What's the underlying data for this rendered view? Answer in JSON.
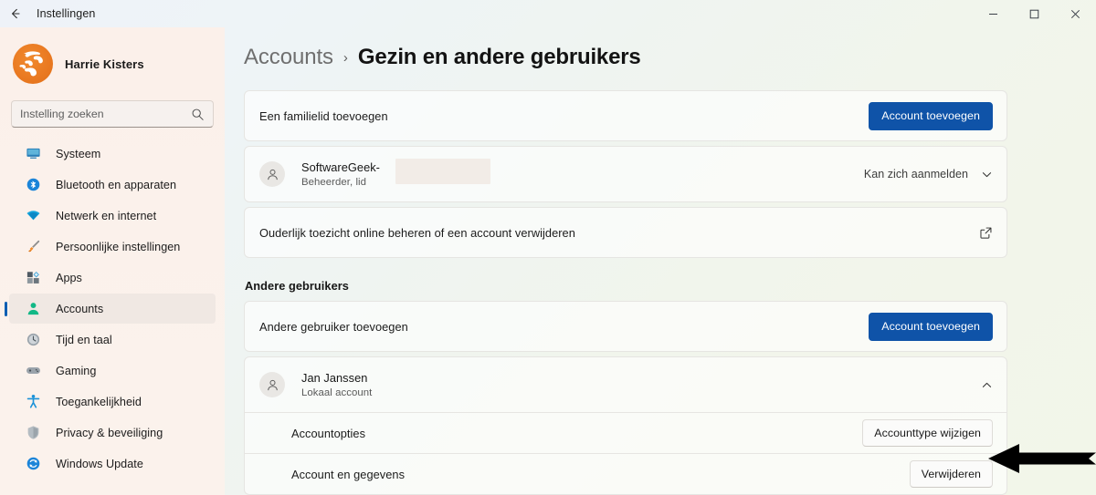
{
  "titlebar": {
    "back_icon": "arrow-left-icon",
    "title": "Instellingen",
    "minimize_label": "—",
    "maximize_label": "□",
    "close_label": "✕"
  },
  "sidebar": {
    "profile": {
      "name": "Harrie Kisters",
      "avatar_icon": "user-avatar-logo",
      "avatar_color": "#ea7a22"
    },
    "search": {
      "placeholder": "Instelling zoeken",
      "value": "",
      "icon": "search-icon"
    },
    "items": [
      {
        "label": "Systeem",
        "icon": "monitor-icon",
        "selected": false
      },
      {
        "label": "Bluetooth en apparaten",
        "icon": "bluetooth-icon",
        "selected": false
      },
      {
        "label": "Netwerk en internet",
        "icon": "wifi-icon",
        "selected": false
      },
      {
        "label": "Persoonlijke instellingen",
        "icon": "paintbrush-icon",
        "selected": false
      },
      {
        "label": "Apps",
        "icon": "apps-grid-icon",
        "selected": false
      },
      {
        "label": "Accounts",
        "icon": "person-icon",
        "selected": true
      },
      {
        "label": "Tijd en taal",
        "icon": "clock-icon",
        "selected": false
      },
      {
        "label": "Gaming",
        "icon": "gamepad-icon",
        "selected": false
      },
      {
        "label": "Toegankelijkheid",
        "icon": "accessibility-icon",
        "selected": false
      },
      {
        "label": "Privacy & beveiliging",
        "icon": "shield-icon",
        "selected": false
      },
      {
        "label": "Windows Update",
        "icon": "update-icon",
        "selected": false
      }
    ]
  },
  "breadcrumb": {
    "parent": "Accounts",
    "separator": "›",
    "current": "Gezin en andere gebruikers"
  },
  "family": {
    "add_member_row": {
      "label": "Een familielid toevoegen",
      "button": "Account toevoegen"
    },
    "member": {
      "name": "SoftwareGeek-",
      "subtitle": "Beheerder, lid",
      "status": "Kan zich aanmelden",
      "avatar_icon": "person-avatar-icon",
      "chevron_icon": "chevron-down-icon",
      "redacted": true
    },
    "manage_online_row": {
      "label": "Ouderlijk toezicht online beheren of een account verwijderen",
      "icon": "external-link-icon"
    }
  },
  "other_users": {
    "section_title": "Andere gebruikers",
    "add_user_row": {
      "label": "Andere gebruiker toevoegen",
      "button": "Account toevoegen"
    },
    "user": {
      "name": "Jan Janssen",
      "subtitle": "Lokaal account",
      "avatar_icon": "person-avatar-icon",
      "chevron_icon": "chevron-up-icon",
      "expanded": true
    },
    "options": [
      {
        "label": "Accountopties",
        "button": "Accounttype wijzigen"
      },
      {
        "label": "Account en gegevens",
        "button": "Verwijderen"
      }
    ]
  },
  "annotation": {
    "arrow_icon": "left-pointing-arrow-annotation",
    "color": "#000000"
  },
  "colors": {
    "accent_blue": "#0f53a8",
    "selection_indicator": "#0b5fb3",
    "sidebar_bg": "#fbf1eb"
  }
}
